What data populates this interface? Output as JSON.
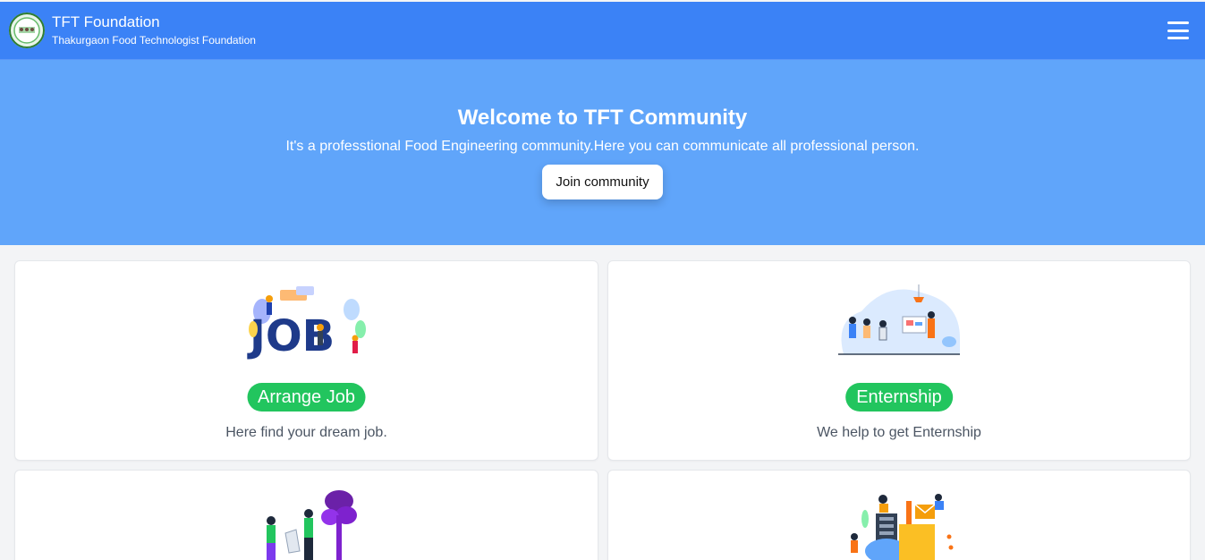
{
  "header": {
    "title": "TFT Foundation",
    "subtitle": "Thakurgaon Food Technologist Foundation",
    "logo_icon": "tft-logo-icon",
    "menu_icon": "hamburger-menu-icon"
  },
  "hero": {
    "heading": "Welcome to TFT Community",
    "text": "It's a professtional Food Engineering community.Here you can communicate all professional person.",
    "button_label": "Join community"
  },
  "cards": [
    {
      "title": "Arrange Job",
      "description": "Here find your dream job.",
      "illustration": "job-illustration"
    },
    {
      "title": "Enternship",
      "description": "We help to get Enternship",
      "illustration": "internship-meeting-illustration"
    },
    {
      "title": "",
      "description": "",
      "illustration": "community-tree-illustration"
    },
    {
      "title": "",
      "description": "",
      "illustration": "digital-services-illustration"
    }
  ],
  "colors": {
    "navbar": "#3b82f6",
    "hero": "#60a5fa",
    "pill": "#22c55e",
    "background": "#f3f4f6"
  }
}
